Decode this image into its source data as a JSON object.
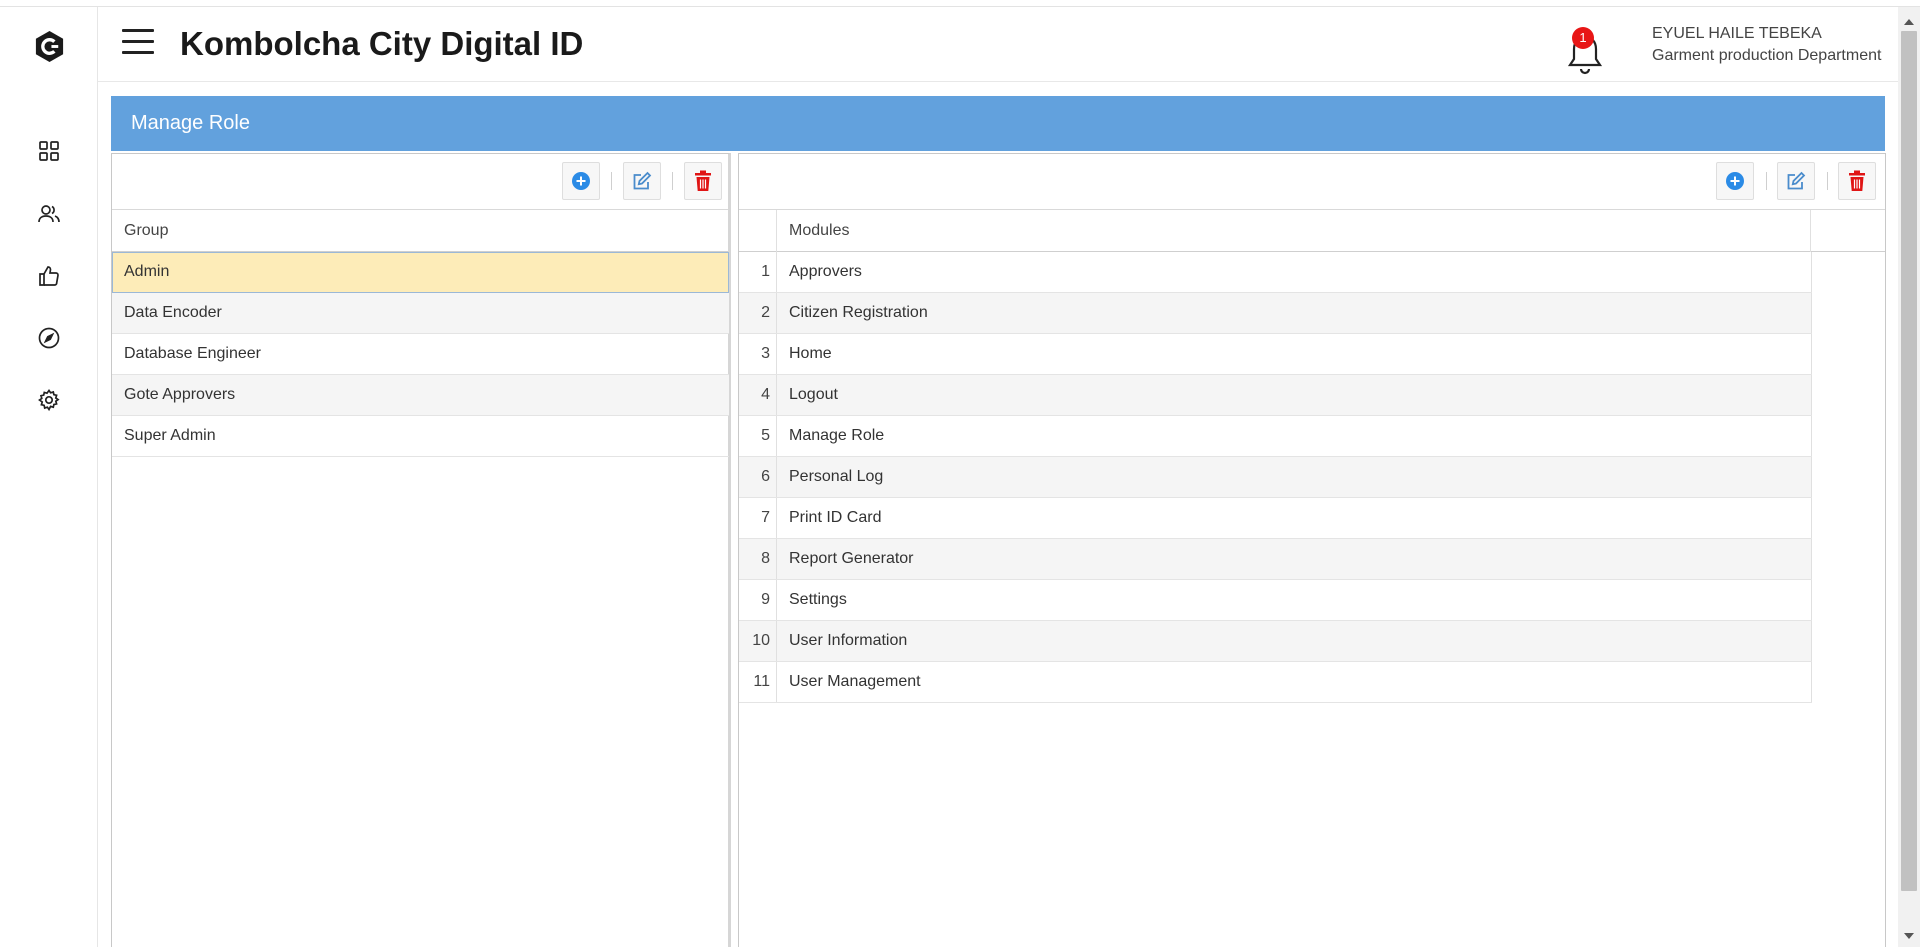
{
  "app": {
    "title": "Kombolcha City Digital ID"
  },
  "user": {
    "name": "EYUEL HAILE TEBEKA",
    "department": "Garment production Department"
  },
  "notifications": {
    "count": "1"
  },
  "sidebar": {
    "items": [
      {
        "icon": "dashboard-icon"
      },
      {
        "icon": "users-icon"
      },
      {
        "icon": "thumbs-up-icon"
      },
      {
        "icon": "compass-icon"
      },
      {
        "icon": "gear-icon"
      }
    ]
  },
  "panel": {
    "title": "Manage Role"
  },
  "groups": {
    "header": "Group",
    "rows": [
      "Admin",
      "Data Encoder",
      "Database Engineer",
      "Gote Approvers",
      "Super Admin"
    ],
    "selected_index": 0
  },
  "modules": {
    "header": "Modules",
    "rows": [
      {
        "num": "1",
        "name": "Approvers"
      },
      {
        "num": "2",
        "name": "Citizen Registration"
      },
      {
        "num": "3",
        "name": "Home"
      },
      {
        "num": "4",
        "name": "Logout"
      },
      {
        "num": "5",
        "name": "Manage Role"
      },
      {
        "num": "6",
        "name": "Personal Log"
      },
      {
        "num": "7",
        "name": "Print ID Card"
      },
      {
        "num": "8",
        "name": "Report Generator"
      },
      {
        "num": "9",
        "name": "Settings"
      },
      {
        "num": "10",
        "name": "User Information"
      },
      {
        "num": "11",
        "name": "User Management"
      }
    ]
  },
  "colors": {
    "accent": "#62a1dd",
    "add": "#2b8be6",
    "edit": "#4a8ccc",
    "delete": "#e01515",
    "selected_row": "#fdecb8"
  }
}
